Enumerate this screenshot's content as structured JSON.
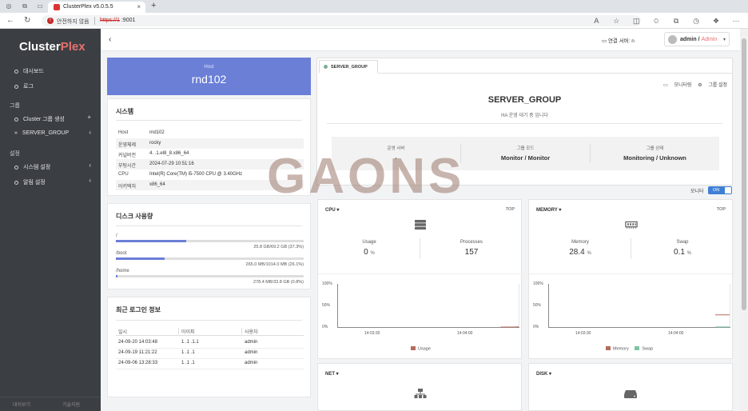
{
  "browser": {
    "tab_title": "ClusterPlex v5.0.5.5",
    "insecure_label": "안전하지 않음",
    "url_scheme": "https://1",
    "url_rest": "        :9001"
  },
  "sidebar": {
    "logo_main": "Cluster",
    "logo_accent": "Plex",
    "items": [
      {
        "label": "대시보드"
      },
      {
        "label": "로그"
      }
    ],
    "group_section": "그룹",
    "group_items": [
      {
        "label": "Cluster 그룹 생성",
        "suffix": "+"
      },
      {
        "label": "SERVER_GROUP",
        "suffix": "‹"
      }
    ],
    "settings_section": "설정",
    "settings_items": [
      {
        "label": "시스템 설정",
        "suffix": "‹"
      },
      {
        "label": "알림 설정",
        "suffix": "‹"
      }
    ],
    "bottom_left": "대쉬보기",
    "bottom_right": "기술지원"
  },
  "header": {
    "connected_label": "연결 서버: n",
    "user": "admin",
    "role": "Admin"
  },
  "host": {
    "label": "Host",
    "name": "rnd102"
  },
  "system": {
    "title": "시스템",
    "rows": [
      {
        "k": "Host",
        "v": "rnd102"
      },
      {
        "k": "운영체제",
        "v": "rocky"
      },
      {
        "k": "커널버전",
        "v": "4.              .1.el8_8.x86_64"
      },
      {
        "k": "부팅시간",
        "v": "2024-07-29 10:51:16"
      },
      {
        "k": "CPU",
        "v": "Intel(R) Core(TM) i5-7500 CPU @ 3.40GHz"
      },
      {
        "k": "아키텍처",
        "v": "x86_64"
      }
    ]
  },
  "disk": {
    "title": "디스크 사용량",
    "items": [
      {
        "path": "/",
        "text": "25.8 GB/69.2 GB (37.3%)",
        "percent": 37.3
      },
      {
        "path": "/boot",
        "text": "265.0 MB/1014.0 MB (26.1%)",
        "percent": 26.1
      },
      {
        "path": "/home",
        "text": "278.4 MB/33.8 GB (0.8%)",
        "percent": 0.8
      }
    ]
  },
  "logins": {
    "title": "최근 로그인 정보",
    "headers": [
      "일시",
      "아이피",
      "사용자"
    ],
    "rows": [
      [
        "24-09-20 14:03:48",
        "1    .1    .1.1",
        "admin"
      ],
      [
        "24-09-19 11:21:22",
        "1    .1    .1",
        "admin"
      ],
      [
        "24-09-06 13:28:33",
        "1    .1    .1",
        "admin"
      ]
    ]
  },
  "group": {
    "tab_label": "SERVER_GROUP",
    "monitoring_link": "모니터링",
    "settings_link": "그룹 설정",
    "title": "SERVER_GROUP",
    "subtitle": "HA 운영 대기 중 입니다",
    "info": [
      {
        "h": "운영 서버",
        "v": "-"
      },
      {
        "h": "그룹 모드",
        "v": "Monitor / Monitor"
      },
      {
        "h": "그룹 상태",
        "v": "Monitoring / Unknown"
      }
    ],
    "monitor_label": "모니터",
    "toggle": "ON"
  },
  "cpu": {
    "name": "CPU",
    "top": "TOP",
    "stats": [
      {
        "h": "Usage",
        "v": "0",
        "u": "%"
      },
      {
        "h": "Processes",
        "v": "157",
        "u": ""
      }
    ]
  },
  "memory": {
    "name": "MEMORY",
    "top": "TOP",
    "stats": [
      {
        "h": "Memory",
        "v": "28.4",
        "u": "%"
      },
      {
        "h": "Swap",
        "v": "0.1",
        "u": "%"
      }
    ]
  },
  "net": {
    "name": "NET"
  },
  "diskpanel": {
    "name": "DISK"
  },
  "chart_data": [
    {
      "type": "line",
      "title": "",
      "xlabel": "",
      "ylabel": "",
      "x_ticks": [
        "14:03:30",
        "14:04:00"
      ],
      "y_ticks": [
        "100%",
        "50%",
        "0%"
      ],
      "ylim": [
        0,
        100
      ],
      "series": [
        {
          "name": "Usage",
          "color": "#b56b5e",
          "values": [
            0,
            0,
            0,
            0,
            0,
            0,
            0,
            0,
            0.5,
            0.8
          ]
        }
      ]
    },
    {
      "type": "line",
      "title": "",
      "xlabel": "",
      "ylabel": "",
      "x_ticks": [
        "14:03:30",
        "14:04:00"
      ],
      "y_ticks": [
        "100%",
        "50%",
        "0%"
      ],
      "ylim": [
        0,
        100
      ],
      "series": [
        {
          "name": "Memory",
          "color": "#b56b5e",
          "values": [
            28.4
          ]
        },
        {
          "name": "Swap",
          "color": "#7cc4a4",
          "values": [
            0.1
          ]
        }
      ]
    }
  ],
  "watermark": "GAONS",
  "colors": {
    "accent": "#6b7fd7",
    "brand": "#e8716b",
    "sidebar": "#3b3f44",
    "toggle": "#3f7fd4"
  }
}
